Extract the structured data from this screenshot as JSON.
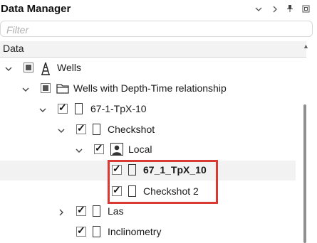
{
  "panel": {
    "title": "Data Manager"
  },
  "title_icons": [
    "chevron-down-icon",
    "chevron-right-icon",
    "pin-icon",
    "restore-window-icon"
  ],
  "filter": {
    "placeholder": "Filter",
    "value": ""
  },
  "column": {
    "label": "Data"
  },
  "tree": [
    {
      "label": "Wells",
      "icon": "derrick-icon",
      "check": "partial",
      "expanded": true,
      "level": 0
    },
    {
      "label": "Wells with Depth-Time relationship",
      "icon": "folder-icon",
      "check": "partial",
      "expanded": true,
      "level": 1
    },
    {
      "label": "67-1-TpX-10",
      "icon": "document-icon",
      "check": "checked",
      "expanded": true,
      "level": 2
    },
    {
      "label": "Checkshot",
      "icon": "document-icon",
      "check": "checked",
      "expanded": true,
      "level": 3
    },
    {
      "label": "Local",
      "icon": "user-icon",
      "check": "checked",
      "expanded": true,
      "level": 4
    },
    {
      "label": "67_1_TpX_10",
      "icon": "document-icon",
      "check": "checked",
      "bold": true,
      "selected": true,
      "level": 5
    },
    {
      "label": "Checkshot 2",
      "icon": "document-icon",
      "check": "checked",
      "level": 5
    },
    {
      "label": "Las",
      "icon": "document-icon",
      "check": "checked",
      "expanded": false,
      "level": 3
    },
    {
      "label": "Inclinometry",
      "icon": "document-icon",
      "check": "checked",
      "level": 3
    }
  ],
  "accent": {
    "highlight": "#d83a33"
  }
}
